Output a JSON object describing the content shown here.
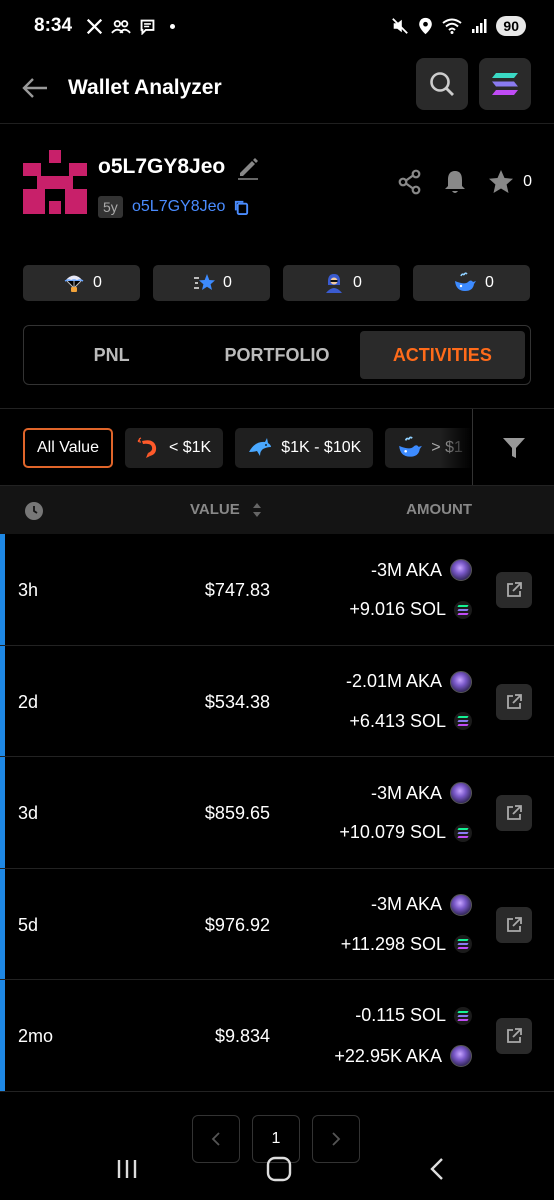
{
  "status_bar": {
    "time": "8:34",
    "battery": "90"
  },
  "header": {
    "title": "Wallet Analyzer"
  },
  "wallet": {
    "name": "o5L7GY8Jeo",
    "age": "5y",
    "address": "o5L7GY8Jeo",
    "star_count": "0"
  },
  "stats": [
    {
      "icon": "airdrop-icon",
      "value": "0"
    },
    {
      "icon": "smart-money-icon",
      "value": "0"
    },
    {
      "icon": "insider-icon",
      "value": "0"
    },
    {
      "icon": "whale-icon",
      "value": "0"
    }
  ],
  "tabs": [
    {
      "label": "PNL",
      "active": false
    },
    {
      "label": "PORTFOLIO",
      "active": false
    },
    {
      "label": "ACTIVITIES",
      "active": true
    }
  ],
  "filters": [
    {
      "label": "All Value",
      "icon": "",
      "active": true
    },
    {
      "label": "< $1K",
      "icon": "shrimp-icon",
      "active": false
    },
    {
      "label": "$1K - $10K",
      "icon": "dolphin-icon",
      "active": false
    },
    {
      "label": "> $1",
      "icon": "whale-icon",
      "active": false
    }
  ],
  "table": {
    "headers": {
      "value": "VALUE",
      "amount": "AMOUNT"
    },
    "rows": [
      {
        "time": "3h",
        "value": "$747.83",
        "amount1": "-3M AKA",
        "token1": "aka",
        "amount2": "+9.016 SOL",
        "token2": "sol"
      },
      {
        "time": "2d",
        "value": "$534.38",
        "amount1": "-2.01M AKA",
        "token1": "aka",
        "amount2": "+6.413 SOL",
        "token2": "sol"
      },
      {
        "time": "3d",
        "value": "$859.65",
        "amount1": "-3M AKA",
        "token1": "aka",
        "amount2": "+10.079 SOL",
        "token2": "sol"
      },
      {
        "time": "5d",
        "value": "$976.92",
        "amount1": "-3M AKA",
        "token1": "aka",
        "amount2": "+11.298 SOL",
        "token2": "sol"
      },
      {
        "time": "2mo",
        "value": "$9.834",
        "amount1": "-0.115 SOL",
        "token1": "sol",
        "amount2": "+22.95K AKA",
        "token2": "aka"
      }
    ]
  },
  "pagination": {
    "current_page": "1"
  },
  "colors": {
    "accent": "#ff6b1a",
    "link": "#4a8cff",
    "row_bar": "#1e88e5"
  }
}
